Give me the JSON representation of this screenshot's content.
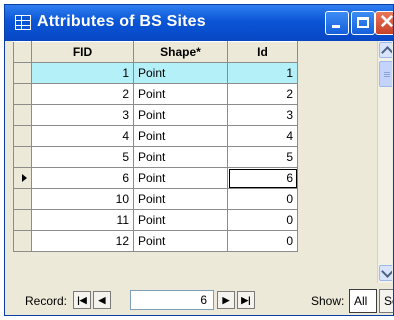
{
  "window": {
    "title": "Attributes of BS Sites",
    "table_icon": "table-icon",
    "controls": {
      "minimize": "minimize-icon",
      "maximize": "maximize-icon",
      "close": "close-icon",
      "close_glyph": "✕"
    }
  },
  "table": {
    "columns": [
      "FID",
      "Shape*",
      "Id"
    ],
    "rows": [
      {
        "fid": "1",
        "shape": "Point",
        "id": "1",
        "highlighted": true
      },
      {
        "fid": "2",
        "shape": "Point",
        "id": "2"
      },
      {
        "fid": "3",
        "shape": "Point",
        "id": "3"
      },
      {
        "fid": "4",
        "shape": "Point",
        "id": "4"
      },
      {
        "fid": "5",
        "shape": "Point",
        "id": "5"
      },
      {
        "fid": "6",
        "shape": "Point",
        "id": "6",
        "current": true
      },
      {
        "fid": "10",
        "shape": "Point",
        "id": "0"
      },
      {
        "fid": "11",
        "shape": "Point",
        "id": "0"
      },
      {
        "fid": "12",
        "shape": "Point",
        "id": "0"
      }
    ],
    "highlight_color": "#b4f0f8",
    "current_row_icon": "current-record-arrow-icon"
  },
  "status": {
    "record_label": "Record:",
    "record_value": "6",
    "first_label": "|◀",
    "prev_label": "◀",
    "next_label": "▶",
    "last_label": "▶|",
    "show_label": "Show:",
    "all_label": "All",
    "selected_label": "Sele"
  }
}
